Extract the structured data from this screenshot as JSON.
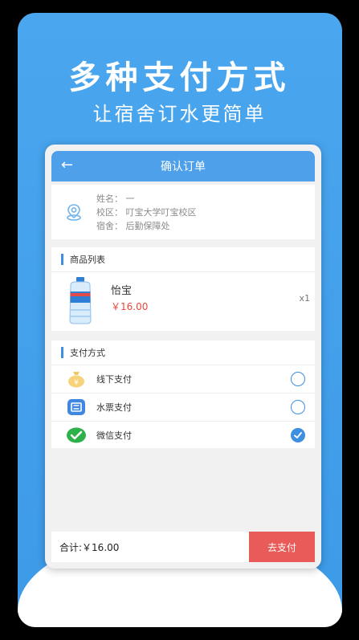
{
  "promo": {
    "headline": "多种支付方式",
    "subline": "让宿舍订水更简单"
  },
  "appbar": {
    "title": "确认订单",
    "back_icon": "arrow-left-icon"
  },
  "address": {
    "name_line": "姓名： 一",
    "campus_line": "校区： 叮宝大学叮宝校区",
    "dorm_line": "宿舍： 后勤保障处"
  },
  "goods": {
    "section_title": "商品列表",
    "items": [
      {
        "name": "怡宝",
        "price": "￥16.00",
        "qty": "x1"
      }
    ]
  },
  "payment": {
    "section_title": "支付方式",
    "methods": [
      {
        "label": "线下支付",
        "icon": "money-bag-icon",
        "selected": false
      },
      {
        "label": "水票支付",
        "icon": "ticket-icon",
        "selected": false
      },
      {
        "label": "微信支付",
        "icon": "wechat-pay-icon",
        "selected": true
      }
    ]
  },
  "footer": {
    "total": "合计:￥16.00",
    "pay_button": "去支付"
  },
  "colors": {
    "accent": "#3d8fe0",
    "price": "#e8473b",
    "pay_button": "#e95b58",
    "background": "#4aa6ee"
  }
}
